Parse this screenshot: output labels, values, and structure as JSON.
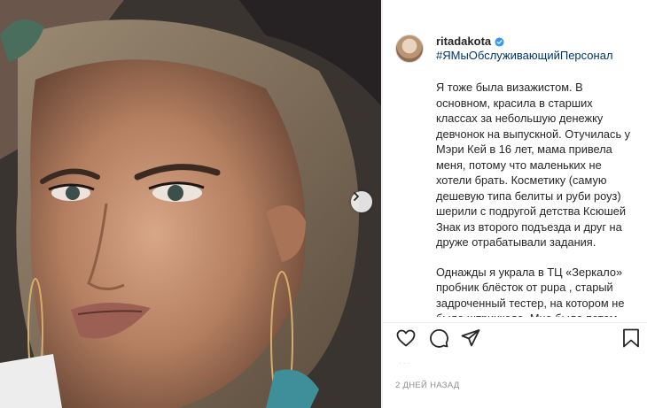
{
  "post": {
    "username": "ritadakota",
    "hashtag": "#ЯМыОбслуживающийПерсонал",
    "caption_paragraphs": [
      "Я тоже была визажистом. В основном, красила в старших классах за небольшую денежку девчонок на выпускной. Отучилась у Мэри Кей в 16 лет, мама привела меня, потому что маленьких не хотели брать. Косметику (самую дешевую типа белиты и руби роуз) шерили с подругой детства Ксюшей Знак из второго подъезда и друг на друже отрабатывали задания.",
      "Однажды я украла в ТЦ «Зеркало» пробник блёсток от pupa , старый задроченный тестер, на котором не было штрихкода. Мне было потом так стыдно, до сих пор помню этот"
    ],
    "date": "2 ДНЕЙ НАЗАД",
    "dots": "·  ·  ·"
  },
  "icons": {
    "verified": "verified-badge-icon",
    "like": "heart-icon",
    "comment": "comment-bubble-icon",
    "share": "paper-plane-icon",
    "save": "bookmark-icon",
    "next": "chevron-right-icon"
  },
  "colors": {
    "verified": "#3897f0",
    "link": "#00376b",
    "text": "#262626",
    "muted": "#8e8e8e"
  }
}
